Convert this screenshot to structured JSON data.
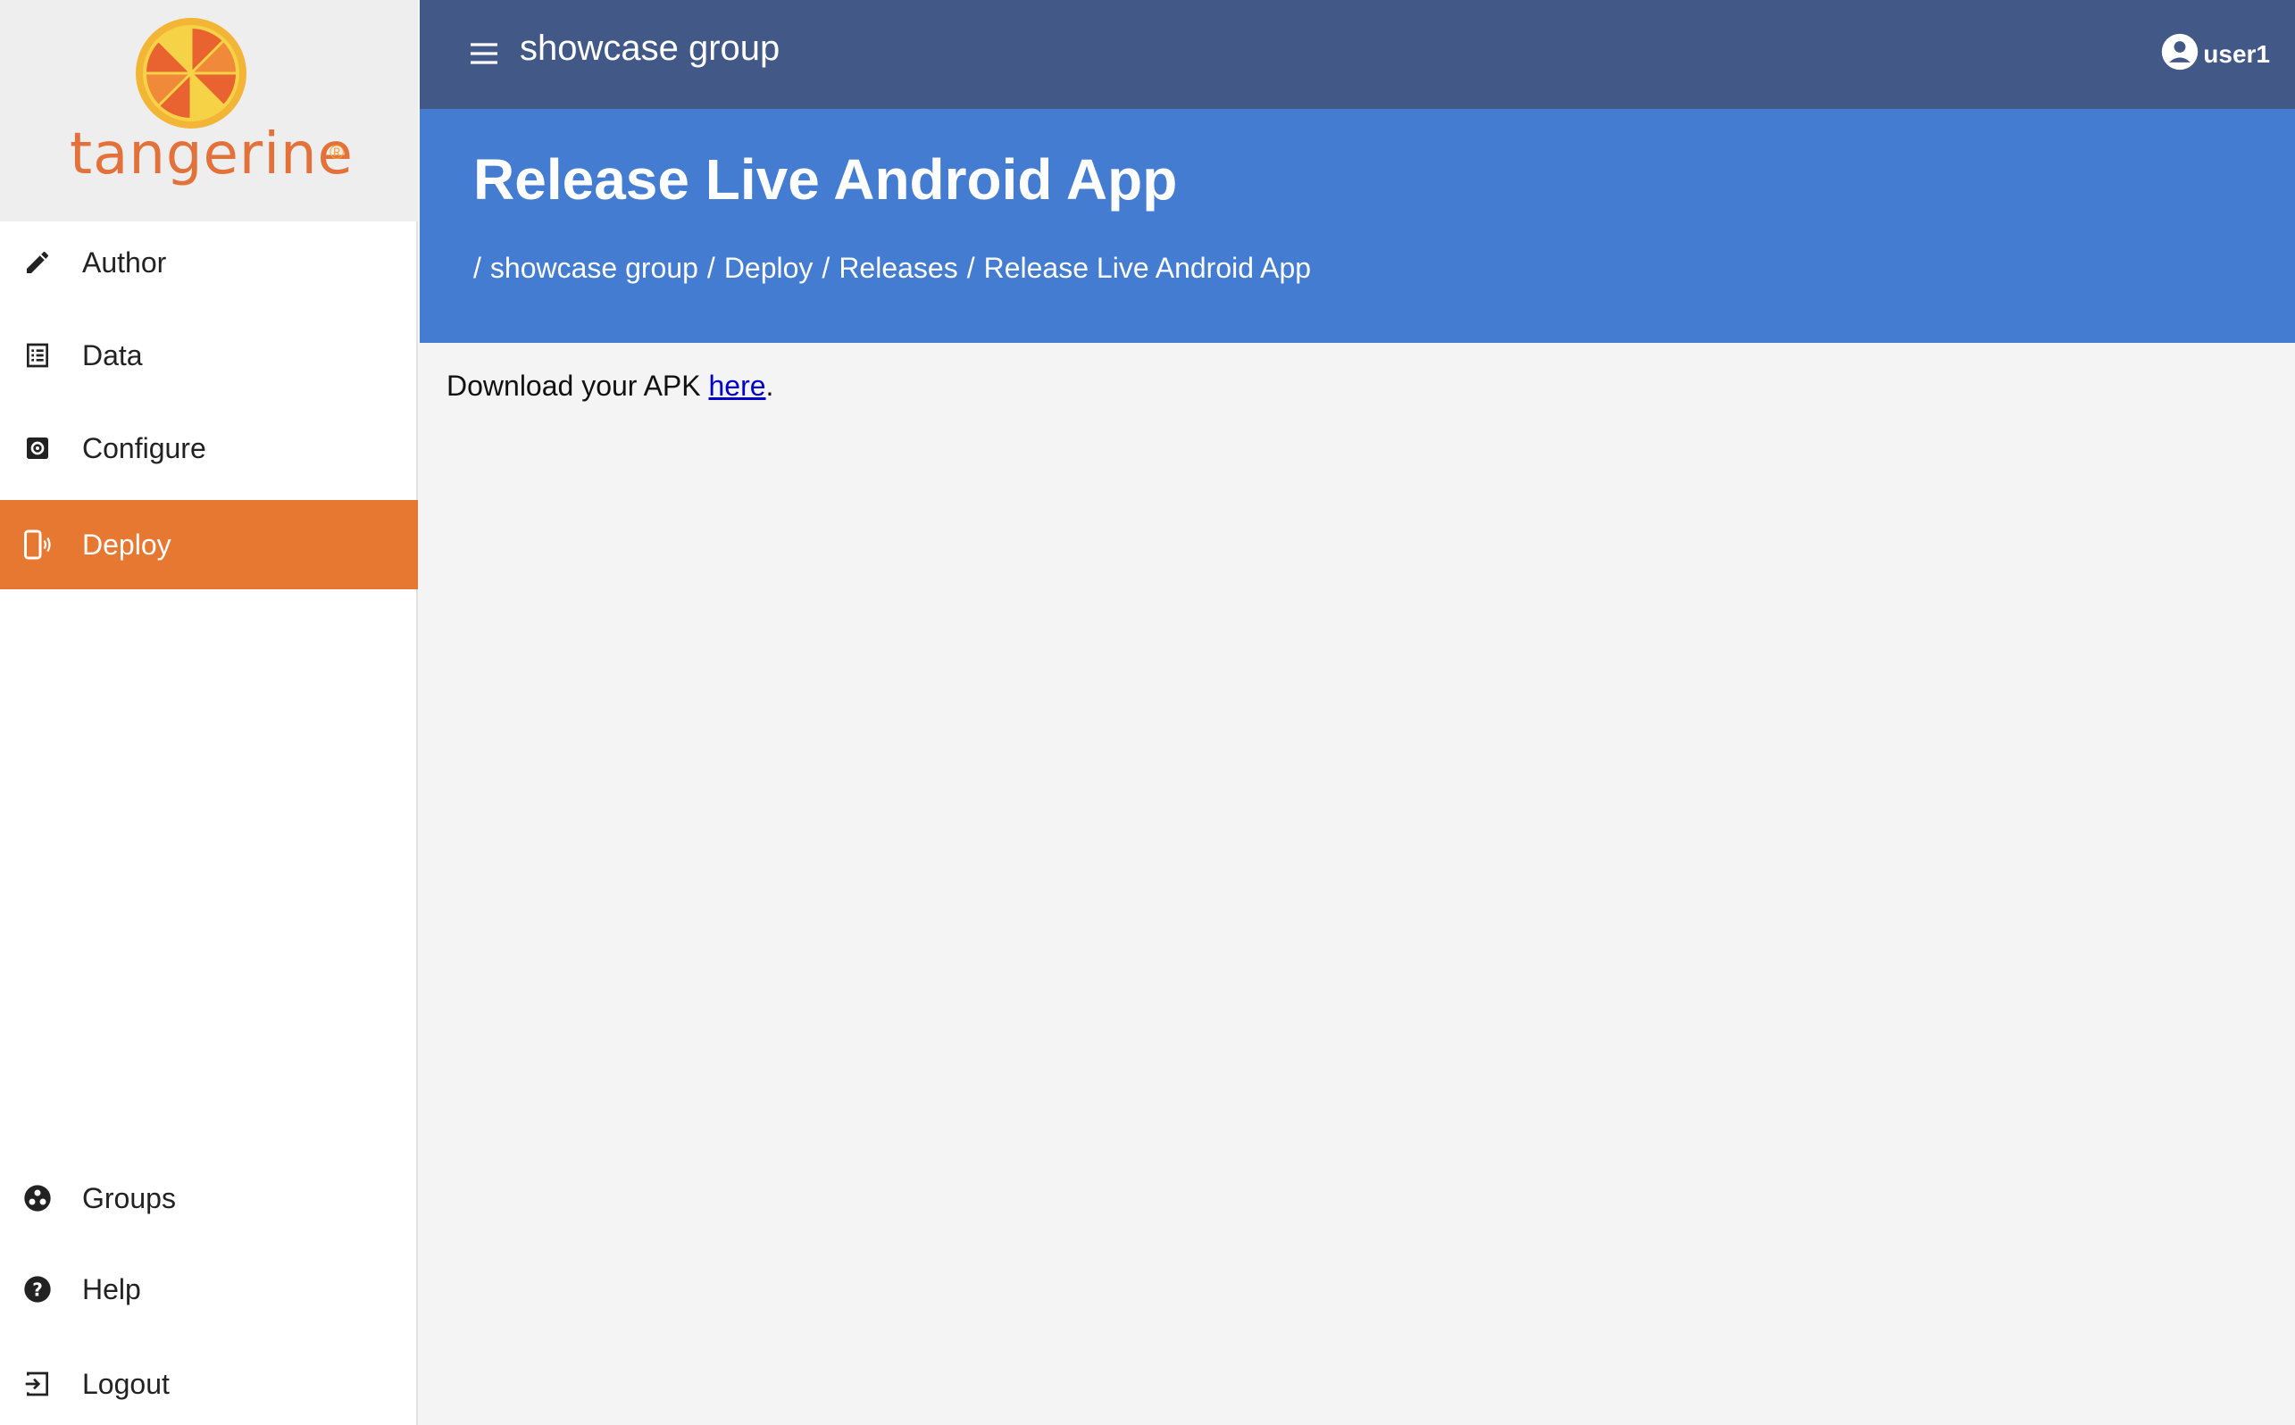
{
  "sidebar": {
    "logo": {
      "text": "tangerine",
      "reg": "®"
    },
    "items": [
      {
        "label": "Author",
        "icon": "pencil-icon"
      },
      {
        "label": "Data",
        "icon": "list-icon"
      },
      {
        "label": "Configure",
        "icon": "settings-box-icon"
      },
      {
        "label": "Deploy",
        "icon": "phone-broadcast-icon",
        "active": true
      }
    ],
    "bottom_items": [
      {
        "label": "Groups",
        "icon": "group-circle-icon"
      },
      {
        "label": "Help",
        "icon": "help-circle-icon"
      },
      {
        "label": "Logout",
        "icon": "logout-icon"
      }
    ]
  },
  "topbar": {
    "menu_icon": "hamburger-menu-icon",
    "group_title": "showcase group",
    "user_icon": "account-circle-icon",
    "username": "user1"
  },
  "header": {
    "title": "Release Live Android App",
    "breadcrumb": [
      "showcase group",
      "Deploy",
      "Releases",
      "Release Live Android App"
    ],
    "separator": "/"
  },
  "content": {
    "text_before": "Download your APK ",
    "link": "here",
    "text_after": "."
  },
  "colors": {
    "topbar": "#425987",
    "header": "#437cd0",
    "active_nav": "#e67832",
    "logo_text": "#e3713a"
  }
}
